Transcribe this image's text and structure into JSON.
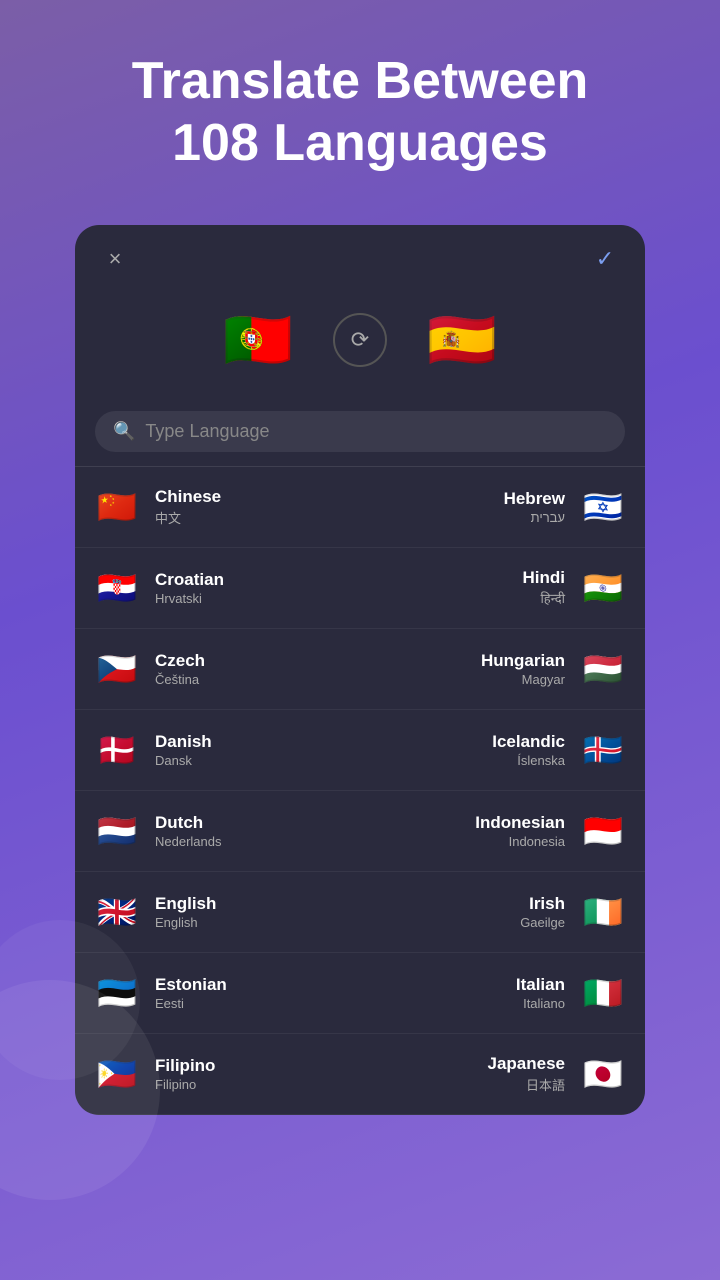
{
  "header": {
    "title_line1": "Translate Between",
    "title_line2": "108 Languages"
  },
  "modal": {
    "close_label": "×",
    "confirm_label": "✓",
    "source_flag": "🇵🇹",
    "target_flag": "🇪🇸",
    "swap_icon": "⟳",
    "search_placeholder": "Type Language"
  },
  "languages": [
    {
      "left": {
        "name": "Chinese",
        "native": "中文",
        "flag": "🇨🇳"
      },
      "right": {
        "name": "Hebrew",
        "native": "עברית",
        "flag": "🇮🇱"
      }
    },
    {
      "left": {
        "name": "Croatian",
        "native": "Hrvatski",
        "flag": "🇭🇷"
      },
      "right": {
        "name": "Hindi",
        "native": "हिन्दी",
        "flag": "🇮🇳"
      }
    },
    {
      "left": {
        "name": "Czech",
        "native": "Čeština",
        "flag": "🇨🇿"
      },
      "right": {
        "name": "Hungarian",
        "native": "Magyar",
        "flag": "🇭🇺"
      }
    },
    {
      "left": {
        "name": "Danish",
        "native": "Dansk",
        "flag": "🇩🇰"
      },
      "right": {
        "name": "Icelandic",
        "native": "Íslenska",
        "flag": "🇮🇸"
      }
    },
    {
      "left": {
        "name": "Dutch",
        "native": "Nederlands",
        "flag": "🇳🇱"
      },
      "right": {
        "name": "Indonesian",
        "native": "Indonesia",
        "flag": "🇮🇩"
      }
    },
    {
      "left": {
        "name": "English",
        "native": "English",
        "flag": "🇬🇧"
      },
      "right": {
        "name": "Irish",
        "native": "Gaeilge",
        "flag": "🇮🇪"
      }
    },
    {
      "left": {
        "name": "Estonian",
        "native": "Eesti",
        "flag": "🇪🇪"
      },
      "right": {
        "name": "Italian",
        "native": "Italiano",
        "flag": "🇮🇹"
      }
    },
    {
      "left": {
        "name": "Filipino",
        "native": "Filipino",
        "flag": "🇵🇭"
      },
      "right": {
        "name": "Japanese",
        "native": "日本語",
        "flag": "🇯🇵"
      }
    }
  ]
}
